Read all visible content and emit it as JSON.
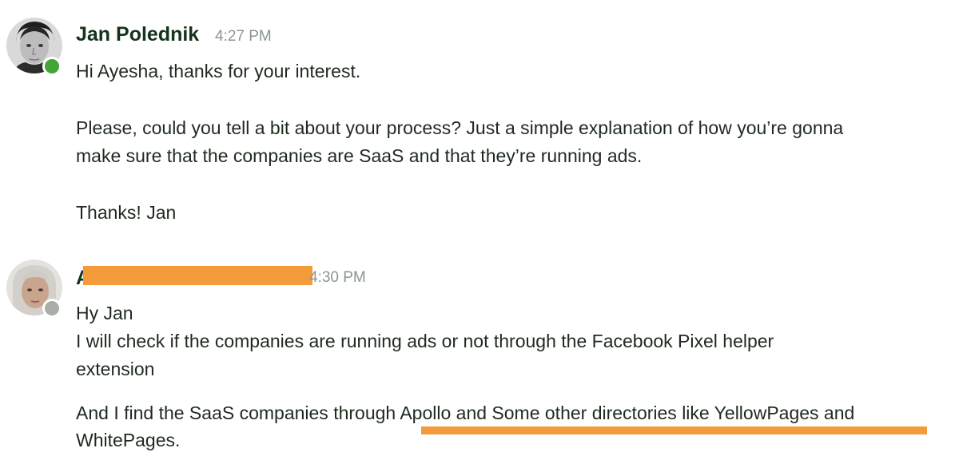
{
  "messages": [
    {
      "sender": "Jan Polednik",
      "time": "4:27 PM",
      "status": "online",
      "lines": [
        "Hi Ayesha, thanks for your interest.",
        "Please, could you tell a bit about your process? Just a simple explanation of how you’re gonna",
        "make sure that the companies are SaaS and that they’re running ads.",
        "Thanks! Jan"
      ]
    },
    {
      "sender_visible_fragment": "A",
      "time_visible_fragment": "4:30 PM",
      "status": "away",
      "lines": [
        "Hy Jan",
        "I will check if the companies are running ads or not through the Facebook Pixel helper",
        "extension",
        "And I find the SaaS companies through Apollo and Some other directories like YellowPages and",
        "WhitePages."
      ]
    }
  ],
  "colors": {
    "online": "#43a536",
    "away": "#a9aea9",
    "highlight": "#f39a3a",
    "name": "#14331c",
    "time": "#8b968d"
  },
  "icons": {
    "avatar_1": "user-avatar-photo",
    "avatar_2": "user-avatar-photo"
  }
}
